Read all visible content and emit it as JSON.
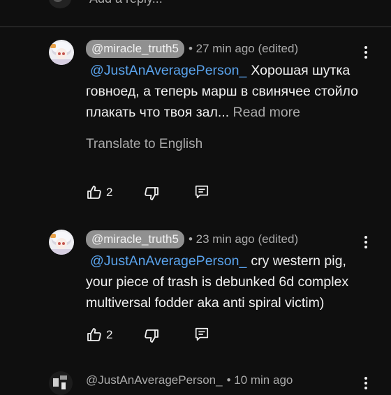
{
  "reply_box": {
    "placeholder": "Add a reply..."
  },
  "comments": [
    {
      "handle": "@miracle_truth5",
      "meta": "• 27 min ago (edited)",
      "mention": "@JustAnAveragePerson_",
      "text": "Хорошая шутка говноед, а теперь марш в свинячее стойло плакать что твоя зал...",
      "read_more": "Read more",
      "translate": "Translate to English",
      "likes": "2"
    },
    {
      "handle": "@miracle_truth5",
      "meta": "• 23 min ago (edited)",
      "mention": "@JustAnAveragePerson_",
      "text": "cry western pig, your piece of trash is debunked 6d complex multiversal fodder aka anti spiral victim)",
      "likes": "2"
    },
    {
      "handle": "@JustAnAveragePerson_",
      "meta": "• 10 min ago"
    }
  ],
  "icons": {
    "like": "thumbs-up-icon",
    "dislike": "thumbs-down-icon",
    "reply": "comment-reply-icon",
    "more": "kebab-menu-icon"
  },
  "colors": {
    "background": "#0f0f0f",
    "mention": "#5aa3ec",
    "secondary_text": "#aaaaaa",
    "handle_pill": "#909090"
  }
}
